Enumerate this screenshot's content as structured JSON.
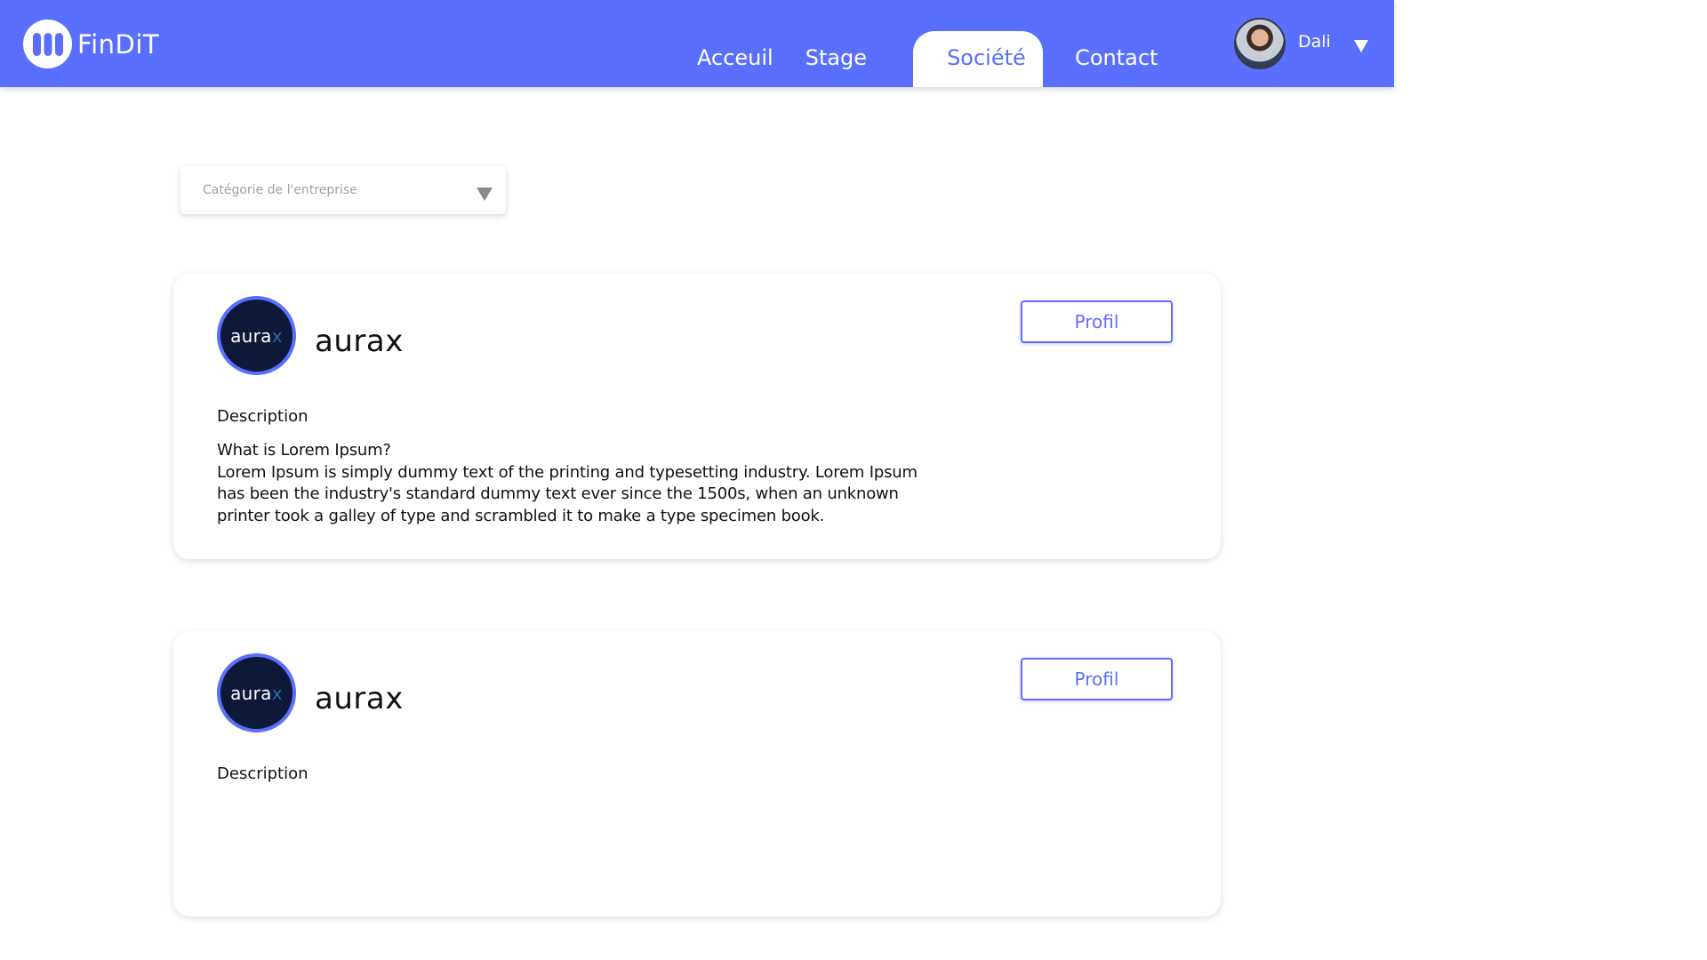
{
  "header": {
    "brand": "FinDiT",
    "nav": [
      {
        "label": "Acceuil"
      },
      {
        "label": "Stage"
      },
      {
        "label": "Société"
      },
      {
        "label": "Contact"
      }
    ],
    "active_nav": "Société",
    "user": {
      "name": "Dali"
    }
  },
  "filter": {
    "placeholder": "Catégorie de l'entreprise"
  },
  "companies": [
    {
      "logo_text": "aura",
      "logo_accent": "x",
      "name": "aurax",
      "profile_label": "Profil",
      "description_label": "Description",
      "description_title": "What is Lorem Ipsum?",
      "description_body": "Lorem Ipsum is simply dummy text of the printing and typesetting industry. Lorem Ipsum has been the industry's standard dummy text ever since the 1500s, when an unknown printer took a galley of type and scrambled it to make a type specimen book."
    },
    {
      "logo_text": "aura",
      "logo_accent": "x",
      "name": "aurax",
      "profile_label": "Profil",
      "description_label": "Description"
    }
  ],
  "colors": {
    "primary": "#5a6ffd",
    "logo_bg": "#0e1838",
    "logo_accent": "#2a6aa8"
  },
  "icons": {
    "brand": "findit-logo-icon",
    "user_menu": "caret-down-icon",
    "filter": "caret-down-icon"
  }
}
